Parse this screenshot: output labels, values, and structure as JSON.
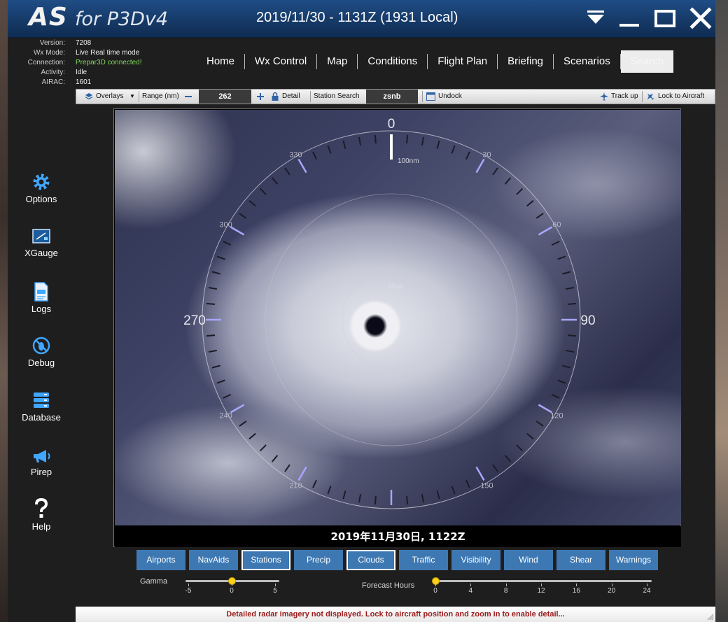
{
  "app": {
    "logo_main": "AS",
    "logo_sub": "for P3Dv4",
    "datetime": "2019/11/30 - 1131Z (1931 Local)"
  },
  "status": [
    {
      "label": "Version:",
      "value": "7208"
    },
    {
      "label": "Wx Mode:",
      "value": "Live Real time mode"
    },
    {
      "label": "Connection:",
      "value": "Prepar3D connected!",
      "color": "#7ed957"
    },
    {
      "label": "Activity:",
      "value": "Idle"
    },
    {
      "label": "AIRAC:",
      "value": "1601"
    }
  ],
  "nav": [
    "Home",
    "Wx Control",
    "Map",
    "Conditions",
    "Flight Plan",
    "Briefing",
    "Scenarios",
    "Search"
  ],
  "nav_active": "Search",
  "sidebar": [
    {
      "label": "Options",
      "icon": "gear-icon"
    },
    {
      "label": "XGauge",
      "icon": "gauge-icon"
    },
    {
      "label": "Logs",
      "icon": "log-file-icon"
    },
    {
      "label": "Debug",
      "icon": "bug-icon"
    },
    {
      "label": "Database",
      "icon": "database-icon"
    },
    {
      "label": "Pirep",
      "icon": "megaphone-icon"
    },
    {
      "label": "Help",
      "icon": "question-icon"
    }
  ],
  "toolbar": {
    "overlays": "Overlays",
    "range_label": "Range (nm)",
    "range_value": "262",
    "detail": "Detail",
    "station_search": "Station Search",
    "station_value": "zsnb",
    "undock": "Undock",
    "track_up": "Track up",
    "lock_aircraft": "Lock to Aircraft"
  },
  "compass": {
    "labels": [
      {
        "heading": 0,
        "text": "0"
      },
      {
        "heading": 30,
        "text": "30"
      },
      {
        "heading": 60,
        "text": "60"
      },
      {
        "heading": 90,
        "text": "90"
      },
      {
        "heading": 120,
        "text": "120"
      },
      {
        "heading": 150,
        "text": "150"
      },
      {
        "heading": 210,
        "text": "210"
      },
      {
        "heading": 240,
        "text": "240"
      },
      {
        "heading": 270,
        "text": "270"
      },
      {
        "heading": 300,
        "text": "300"
      },
      {
        "heading": 330,
        "text": "330"
      }
    ],
    "range_ring_label": "100nm",
    "inner_ring_label": "25nm"
  },
  "map_timestamp": "2019年11月30日, 1122Z",
  "layers": [
    {
      "label": "Airports",
      "on": false
    },
    {
      "label": "NavAids",
      "on": false
    },
    {
      "label": "Stations",
      "on": true
    },
    {
      "label": "Precip",
      "on": false
    },
    {
      "label": "Clouds",
      "on": true
    },
    {
      "label": "Traffic",
      "on": false
    },
    {
      "label": "Visibility",
      "on": false
    },
    {
      "label": "Wind",
      "on": false
    },
    {
      "label": "Shear",
      "on": false
    },
    {
      "label": "Warnings",
      "on": false
    }
  ],
  "gamma": {
    "label": "Gamma",
    "ticks": [
      "-5",
      "0",
      "5"
    ],
    "value": 0
  },
  "forecast": {
    "label": "Forecast Hours",
    "ticks": [
      "0",
      "4",
      "8",
      "12",
      "16",
      "20",
      "24"
    ],
    "value": 0
  },
  "message": "Detailed radar imagery not displayed. Lock to aircraft position and zoom in to enable detail..."
}
